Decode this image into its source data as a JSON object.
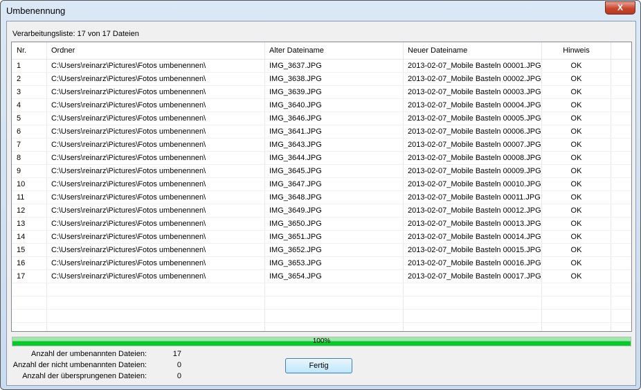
{
  "window": {
    "title": "Umbenennung",
    "close_label": "X"
  },
  "caption": "Verarbeitungsliste: 17 von 17 Dateien",
  "columns": [
    "Nr.",
    "Ordner",
    "Alter Dateiname",
    "Neuer Dateiname",
    "Hinweis"
  ],
  "rows": [
    [
      "1",
      "C:\\Users\\reinarz\\Pictures\\Fotos umbenennen\\",
      "IMG_3637.JPG",
      "2013-02-07_Mobile Basteln 00001.JPG",
      "OK"
    ],
    [
      "2",
      "C:\\Users\\reinarz\\Pictures\\Fotos umbenennen\\",
      "IMG_3638.JPG",
      "2013-02-07_Mobile Basteln 00002.JPG",
      "OK"
    ],
    [
      "3",
      "C:\\Users\\reinarz\\Pictures\\Fotos umbenennen\\",
      "IMG_3639.JPG",
      "2013-02-07_Mobile Basteln 00003.JPG",
      "OK"
    ],
    [
      "4",
      "C:\\Users\\reinarz\\Pictures\\Fotos umbenennen\\",
      "IMG_3640.JPG",
      "2013-02-07_Mobile Basteln 00004.JPG",
      "OK"
    ],
    [
      "5",
      "C:\\Users\\reinarz\\Pictures\\Fotos umbenennen\\",
      "IMG_3646.JPG",
      "2013-02-07_Mobile Basteln 00005.JPG",
      "OK"
    ],
    [
      "6",
      "C:\\Users\\reinarz\\Pictures\\Fotos umbenennen\\",
      "IMG_3641.JPG",
      "2013-02-07_Mobile Basteln 00006.JPG",
      "OK"
    ],
    [
      "7",
      "C:\\Users\\reinarz\\Pictures\\Fotos umbenennen\\",
      "IMG_3643.JPG",
      "2013-02-07_Mobile Basteln 00007.JPG",
      "OK"
    ],
    [
      "8",
      "C:\\Users\\reinarz\\Pictures\\Fotos umbenennen\\",
      "IMG_3644.JPG",
      "2013-02-07_Mobile Basteln 00008.JPG",
      "OK"
    ],
    [
      "9",
      "C:\\Users\\reinarz\\Pictures\\Fotos umbenennen\\",
      "IMG_3645.JPG",
      "2013-02-07_Mobile Basteln 00009.JPG",
      "OK"
    ],
    [
      "10",
      "C:\\Users\\reinarz\\Pictures\\Fotos umbenennen\\",
      "IMG_3647.JPG",
      "2013-02-07_Mobile Basteln 00010.JPG",
      "OK"
    ],
    [
      "11",
      "C:\\Users\\reinarz\\Pictures\\Fotos umbenennen\\",
      "IMG_3648.JPG",
      "2013-02-07_Mobile Basteln 00011.JPG",
      "OK"
    ],
    [
      "12",
      "C:\\Users\\reinarz\\Pictures\\Fotos umbenennen\\",
      "IMG_3649.JPG",
      "2013-02-07_Mobile Basteln 00012.JPG",
      "OK"
    ],
    [
      "13",
      "C:\\Users\\reinarz\\Pictures\\Fotos umbenennen\\",
      "IMG_3650.JPG",
      "2013-02-07_Mobile Basteln 00013.JPG",
      "OK"
    ],
    [
      "14",
      "C:\\Users\\reinarz\\Pictures\\Fotos umbenennen\\",
      "IMG_3651.JPG",
      "2013-02-07_Mobile Basteln 00014.JPG",
      "OK"
    ],
    [
      "15",
      "C:\\Users\\reinarz\\Pictures\\Fotos umbenennen\\",
      "IMG_3652.JPG",
      "2013-02-07_Mobile Basteln 00015.JPG",
      "OK"
    ],
    [
      "16",
      "C:\\Users\\reinarz\\Pictures\\Fotos umbenennen\\",
      "IMG_3653.JPG",
      "2013-02-07_Mobile Basteln 00016.JPG",
      "OK"
    ],
    [
      "17",
      "C:\\Users\\reinarz\\Pictures\\Fotos umbenennen\\",
      "IMG_3654.JPG",
      "2013-02-07_Mobile Basteln 00017.JPG",
      "OK"
    ]
  ],
  "progress": {
    "percent": 100,
    "label": "100%",
    "color": "#06c92c"
  },
  "stats": [
    {
      "label": "Anzahl der umbenannten Dateien:",
      "value": "17"
    },
    {
      "label": "Anzahl der nicht umbenannten Dateien:",
      "value": "0"
    },
    {
      "label": "Anzahl der übersprungenen Dateien:",
      "value": "0"
    }
  ],
  "done_button": "Fertig"
}
